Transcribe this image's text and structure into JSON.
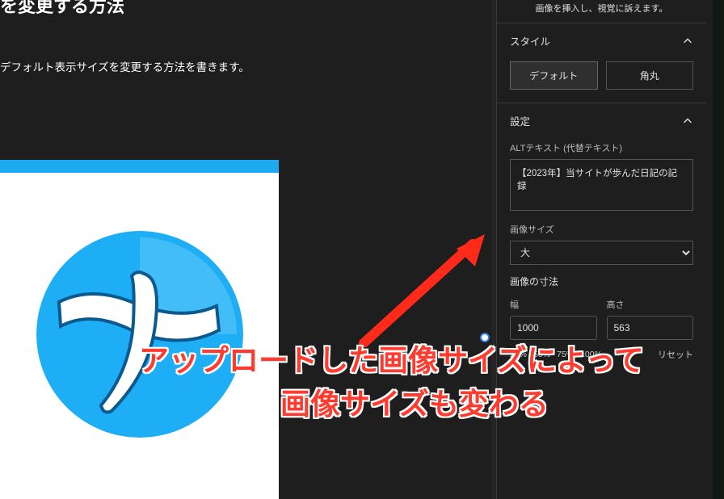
{
  "main": {
    "title_fragment": "を変更する方法",
    "description": "デフォルト表示サイズを変更する方法を書きます。"
  },
  "sidebar": {
    "helper_text": "画像を挿入し、視覚に訴えます。",
    "sections": {
      "style": {
        "title": "スタイル",
        "options": {
          "default": "デフォルト",
          "rounded": "角丸"
        }
      },
      "settings": {
        "title": "設定",
        "alt_label": "ALTテキスト (代替テキスト)",
        "alt_value": "【2023年】当サイトが歩んだ日記の記録",
        "image_size_label": "画像サイズ",
        "image_size_value": "大",
        "dims_label": "画像の寸法",
        "width_label": "幅",
        "width_value": "1000",
        "height_label": "高さ",
        "height_value": "563",
        "pct": {
          "p25": "25%",
          "p50": "50%",
          "p75": "75%",
          "p100": "100%"
        },
        "reset": "リセット"
      }
    }
  },
  "annotation": {
    "line1": "アップロードした画像サイズによって",
    "line2": "画像サイズも変わる"
  }
}
